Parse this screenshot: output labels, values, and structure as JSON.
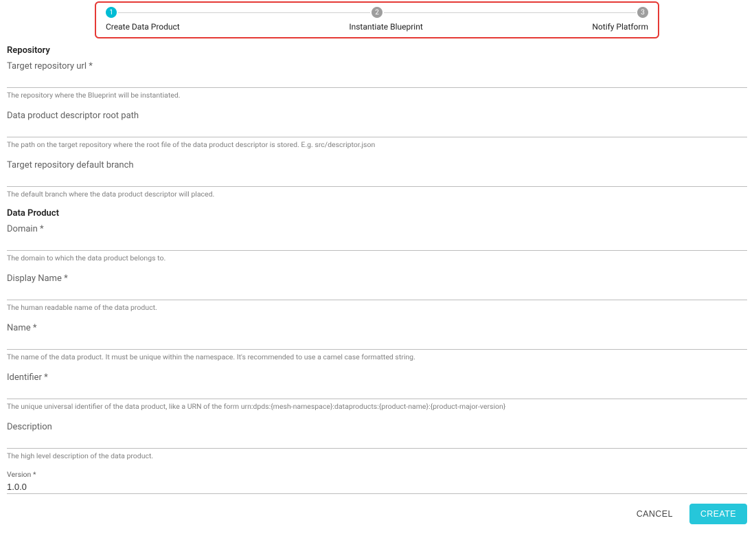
{
  "stepper": {
    "steps": [
      {
        "num": "1",
        "label": "Create Data Product",
        "active": true
      },
      {
        "num": "2",
        "label": "Instantiate Blueprint",
        "active": false
      },
      {
        "num": "3",
        "label": "Notify Platform",
        "active": false
      }
    ]
  },
  "sections": {
    "repository": {
      "title": "Repository",
      "fields": {
        "target_url": {
          "label": "Target repository url *",
          "help": "The repository where the Blueprint will be instantiated."
        },
        "root_path": {
          "label": "Data product descriptor root path",
          "help": "The path on the target repository where the root file of the data product descriptor is stored. E.g. src/descriptor.json"
        },
        "default_branch": {
          "label": "Target repository default branch",
          "help": "The default branch where the data product descriptor will placed."
        }
      }
    },
    "data_product": {
      "title": "Data Product",
      "fields": {
        "domain": {
          "label": "Domain *",
          "help": "The domain to which the data product belongs to."
        },
        "display_name": {
          "label": "Display Name *",
          "help": "The human readable name of the data product."
        },
        "name": {
          "label": "Name *",
          "help": "The name of the data product. It must be unique within the namespace. It's recommended to use a camel case formatted string."
        },
        "identifier": {
          "label": "Identifier *",
          "help": "The unique universal identifier of the data product, like a URN of the form urn:dpds:{mesh-namespace}:dataproducts:{product-name}:{product-major-version}"
        },
        "description": {
          "label": "Description",
          "help": "The high level description of the data product."
        },
        "version": {
          "label": "Version *",
          "value": "1.0.0"
        }
      }
    }
  },
  "buttons": {
    "cancel": "CANCEL",
    "create": "CREATE"
  }
}
